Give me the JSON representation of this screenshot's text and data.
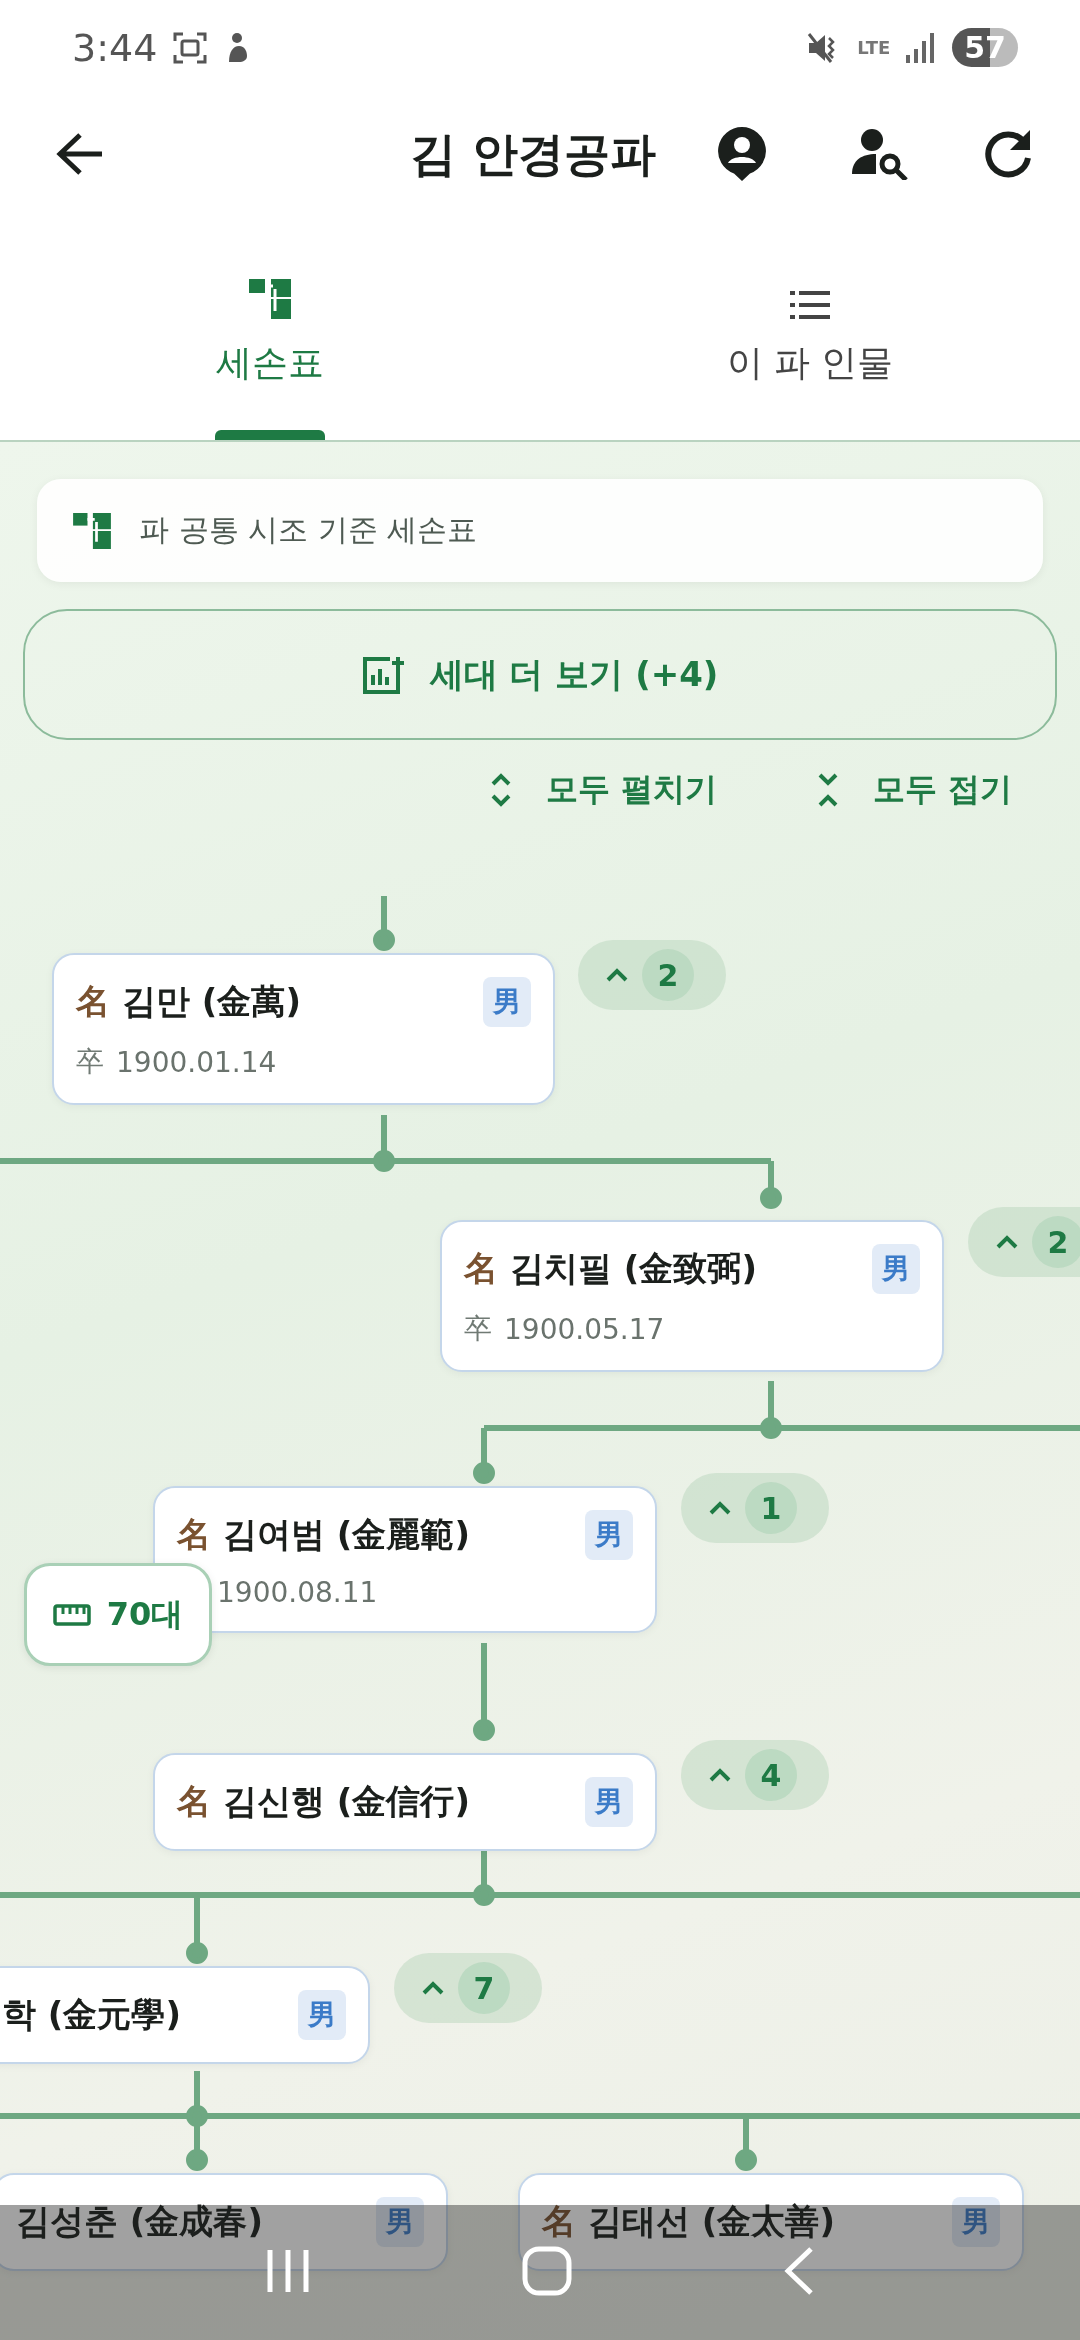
{
  "status_bar": {
    "time": "3:44",
    "network": "LTE",
    "battery": "57"
  },
  "app_bar": {
    "title": "김 안경공파"
  },
  "tabs": [
    {
      "label": "세손표",
      "kind": "tree",
      "selected": true
    },
    {
      "label": "이 파 인물",
      "kind": "list",
      "selected": false
    }
  ],
  "info": {
    "text": "파 공통 시조 기준 세손표"
  },
  "more_button": {
    "label": "세대 더 보기 (+4)"
  },
  "actions": [
    {
      "kind": "expand",
      "label": "모두 펼치기"
    },
    {
      "kind": "collapse",
      "label": "모두 접기"
    }
  ],
  "generation_chip": {
    "label": "70대"
  },
  "tree": [
    {
      "mark": "名",
      "name": "김만 (金萬)",
      "gender": "男",
      "date_mark": "卒",
      "date": "1900.01.14",
      "count": "2",
      "children": [
        {
          "mark": "名",
          "name": "김치필 (金致弼)",
          "gender": "男",
          "date_mark": "卒",
          "date": "1900.05.17",
          "count": "2",
          "children": [
            {
              "mark": "名",
              "name": "김여범 (金麗範)",
              "gender": "男",
              "date": "1900.08.11",
              "count": "1",
              "children": [
                {
                  "mark": "名",
                  "name": "김신행 (金信行)",
                  "gender": "男",
                  "count": "4",
                  "children": [
                    {
                      "name": "학 (金元學)",
                      "gender": "男",
                      "count": "7",
                      "children": [
                        {
                          "name": "김성춘 (金成春)",
                          "gender": "男"
                        },
                        {
                          "mark": "名",
                          "name": "김태선 (金太善)",
                          "gender": "男"
                        }
                      ]
                    }
                  ]
                }
              ]
            }
          ]
        }
      ]
    }
  ]
}
